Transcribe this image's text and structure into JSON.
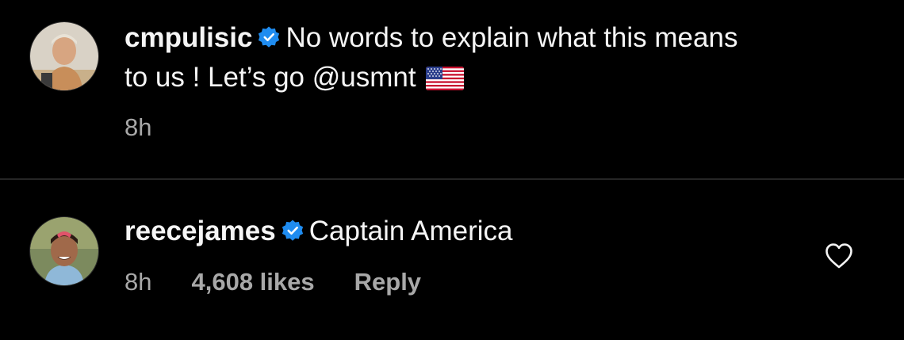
{
  "comments": [
    {
      "username": "cmpulisic",
      "text_line1": "No words to explain what this means",
      "text_line2": "to us ! Let’s go @usmnt",
      "time": "8h"
    },
    {
      "username": "reecejames",
      "text": "Captain America",
      "time": "8h",
      "likes": "4,608 likes",
      "reply_label": "Reply"
    }
  ],
  "icons": {
    "verified": "verified-badge-icon",
    "flag": "us-flag-icon",
    "like": "heart-icon"
  },
  "colors": {
    "background": "#000000",
    "text": "#f5f5f5",
    "muted": "#a8a8a8",
    "verified": "#1f8cf0",
    "divider": "#262626"
  }
}
